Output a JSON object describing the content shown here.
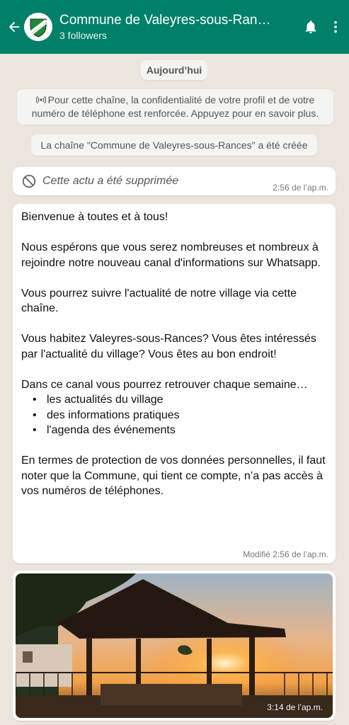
{
  "header": {
    "title": "Commune de Valeyres-sous-Ran…",
    "followers": "3 followers",
    "colors": {
      "bar": "#008069",
      "text": "#ffffff"
    },
    "icons": [
      "back-arrow-icon",
      "bell-icon",
      "more-vert-icon"
    ]
  },
  "chat": {
    "date_chip": "Aujourd’hui",
    "privacy_notice": "Pour cette chaîne, la confidentialité de votre profil et de votre numéro de téléphone est renforcée. Appuyez pour en savoir plus.",
    "created_notice": "La chaîne \"Commune de Valeyres-sous-Rances\" a été créée",
    "deleted": {
      "text": "Cette actu a été supprimée",
      "time": "2:56 de l’ap.m."
    },
    "post": {
      "paragraphs": [
        "Bienvenue à toutes et à tous!",
        "Nous espérons que vous serez nombreuses et nombreux à rejoindre notre nouveau canal d'informations sur Whatsapp.",
        "Vous pourrez suivre l'actualité de notre village via cette chaîne.",
        "Vous habitez Valeyres-sous-Rances? Vous êtes intéressés par l'actualité du village? Vous êtes au bon endroit!",
        "Dans ce canal vous pourrez retrouver chaque semaine…",
        "En termes de protection de vos données personnelles, il faut noter que la Commune, qui tient ce compte, n’a pas accès à vos numéros de téléphones."
      ],
      "bullets": [
        "les actualités du village",
        "des informations pratiques",
        "l'agenda des événements"
      ],
      "time": "Modifié  2:56 de l’ap.m."
    },
    "photo": {
      "time": "3:14 de l’ap.m."
    }
  }
}
